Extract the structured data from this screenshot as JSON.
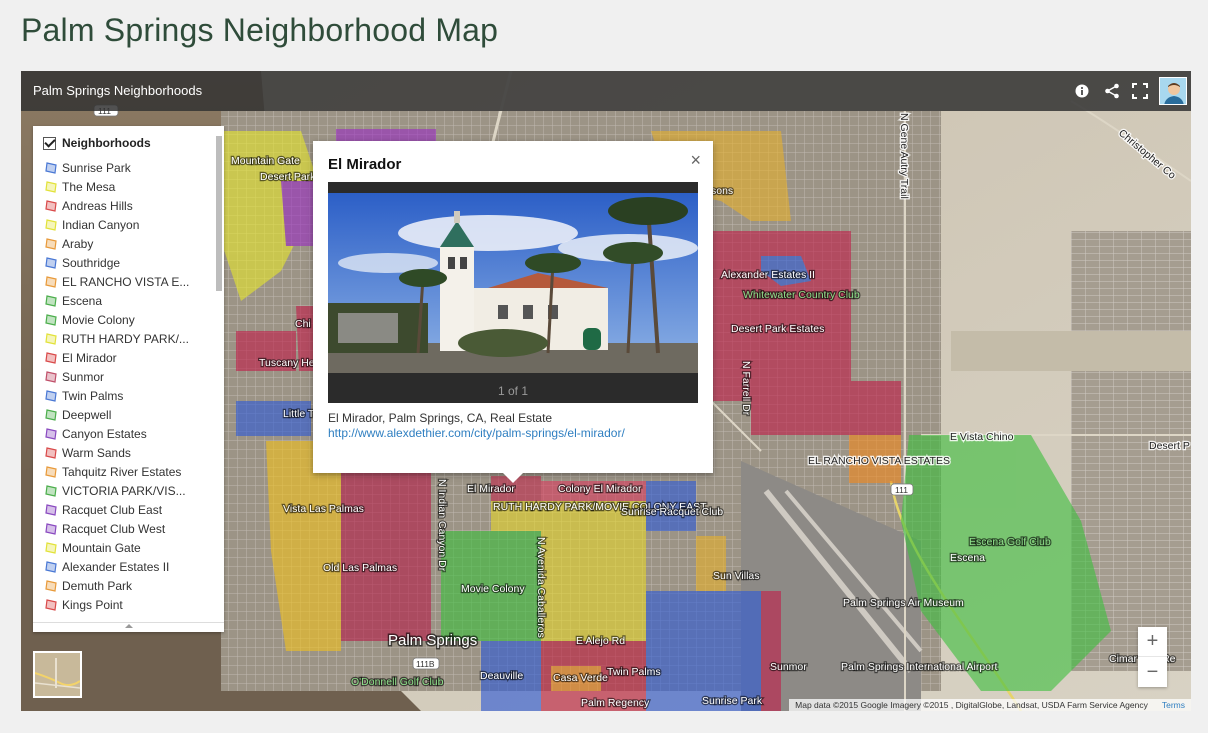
{
  "page": {
    "title": "Palm Springs Neighborhood Map"
  },
  "map": {
    "title": "Palm Springs Neighborhoods",
    "icons": [
      "info-icon",
      "share-icon",
      "fullscreen-icon",
      "user-avatar"
    ],
    "attribution": "Map data ©2015 Google Imagery ©2015 , DigitalGlobe, Landsat, USDA Farm Service Agency",
    "terms": "Terms",
    "zoom_in": "+",
    "zoom_out": "−"
  },
  "legend": {
    "header": "Neighborhoods",
    "items": [
      {
        "label": "Sunrise Park",
        "color": "#4a78d4"
      },
      {
        "label": "The Mesa",
        "color": "#e2e23a"
      },
      {
        "label": "Andreas Hills",
        "color": "#d94a4a"
      },
      {
        "label": "Indian Canyon",
        "color": "#e2e23a"
      },
      {
        "label": "Araby",
        "color": "#e89a3a"
      },
      {
        "label": "Southridge",
        "color": "#4a78d4"
      },
      {
        "label": "EL RANCHO VISTA E...",
        "color": "#e89a3a"
      },
      {
        "label": "Escena",
        "color": "#4cae4c"
      },
      {
        "label": "Movie Colony",
        "color": "#4cae4c"
      },
      {
        "label": "RUTH HARDY PARK/...",
        "color": "#e2e23a"
      },
      {
        "label": "El Mirador",
        "color": "#d94a4a"
      },
      {
        "label": "Sunmor",
        "color": "#c0506a"
      },
      {
        "label": "Twin Palms",
        "color": "#4a78d4"
      },
      {
        "label": "Deepwell",
        "color": "#4cae4c"
      },
      {
        "label": "Canyon Estates",
        "color": "#8a4ac0"
      },
      {
        "label": "Warm Sands",
        "color": "#d94a4a"
      },
      {
        "label": "Tahquitz River Estates",
        "color": "#e89a3a"
      },
      {
        "label": "VICTORIA PARK/VIS...",
        "color": "#4cae4c"
      },
      {
        "label": "Racquet Club East",
        "color": "#8a4ac0"
      },
      {
        "label": "Racquet Club West",
        "color": "#8a4ac0"
      },
      {
        "label": "Mountain Gate",
        "color": "#e2e23a"
      },
      {
        "label": "Alexander Estates II",
        "color": "#4a78d4"
      },
      {
        "label": "Demuth Park",
        "color": "#e89a3a"
      },
      {
        "label": "Kings Point",
        "color": "#d94a4a"
      }
    ]
  },
  "popup": {
    "title": "El Mirador",
    "close": "×",
    "counter": "1 of 1",
    "caption": "El Mirador, Palm Springs, CA, Real Estate",
    "link": "http://www.alexdethier.com/city/palm-springs/el-mirador/"
  },
  "places": {
    "mountain_gate": "Mountain Gate",
    "desert_park": "Desert Park",
    "chi": "Chi",
    "tuscany": "Tuscany He",
    "little": "Little T",
    "alexander": "Alexander Estates II",
    "whitewater": "Whitewater Country Club",
    "desert_park_estates": "Desert Park Estates",
    "vista_chino": "E Vista Chino",
    "el_rancho": "EL RANCHO VISTA ESTATES",
    "escena_golf": "Escena Golf Club",
    "escena": "Escena",
    "vista_las_palmas": "Vista Las Palmas",
    "old_las_palmas": "Old Las Palmas",
    "el_mirador": "El Mirador",
    "colony_el_mirador": "Colony El Mirador",
    "ruth_hardy": "RUTH HARDY PARK/MOVIE COLONY EAST",
    "racquet": "Sunrise Racquet Club",
    "movie_colony": "Movie Colony",
    "sun_villas": "Sun Villas",
    "air_museum": "Palm Springs Air Museum",
    "airport": "Palm Springs International Airport",
    "palm_springs": "Palm Springs",
    "deauville": "Deauville",
    "odonnell": "O'Donnell Golf Club",
    "sunmor": "Sunmor",
    "sunrise_park": "Sunrise Park",
    "palm_regency": "Palm Regency",
    "casa_verde": "Casa Verde",
    "twin_palms": "Twin Palms",
    "alejo": "E Alejo Rd",
    "christopher": "Christopher Co",
    "gene_autry": "N Gene Autry Trail",
    "farrell": "N Farrell Dr",
    "indian_canyon": "N Indian Canyon Dr",
    "avenida": "N Avenida Caballeros",
    "desert_p_golf": "Desert P Golf",
    "cimarron": "Cimar Golf Re",
    "sons": "sons",
    "hwy111": "111",
    "hwy111b": "111B"
  }
}
